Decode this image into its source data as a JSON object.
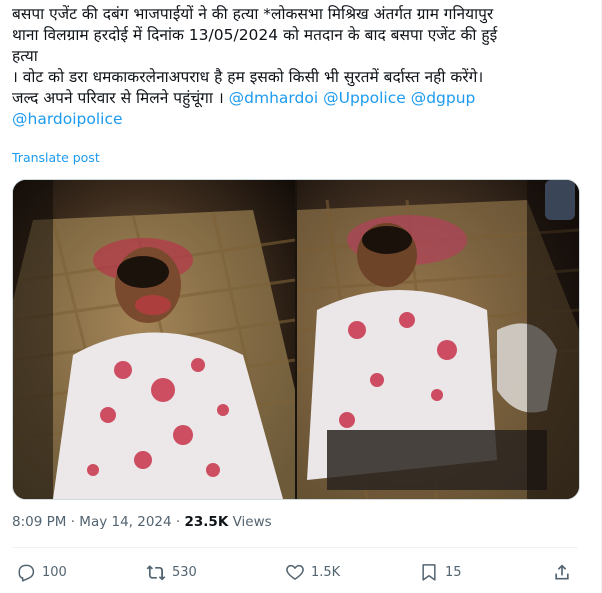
{
  "post": {
    "line1": "बसपा एजेंट की दबंग भाजपाईयों ने की हत्या *लोकसभा मिश्रिख अंतर्गत ग्राम गनियापुर",
    "line2": "थाना विलग्राम हरदोई में दिनांक 13/05/2024 को मतदान के बाद बसपा एजेंट की हुई",
    "line3": "हत्या",
    "line4": "। वोट को डरा धमकाकरलेनाअपराध है हम इसको किसी भी सुरतमें बर्दास्त नही करेंगे।",
    "line5_text": "जल्द अपने परिवार से मिलने पहुंचूंगा । ",
    "mention1": "@dmhardoi",
    "mention2": "@Uppolice",
    "mention3": "@dgpup",
    "mention4": "@hardoipolice",
    "translate_label": "Translate post"
  },
  "meta": {
    "time": "8:09 PM",
    "separator": "·",
    "date": "May 14, 2024",
    "views_count": "23.5K",
    "views_label": "Views"
  },
  "actions": {
    "replies": "100",
    "reposts": "530",
    "likes": "1.5K",
    "bookmarks": "15"
  },
  "icons": {
    "reply": "reply-icon",
    "repost": "repost-icon",
    "like": "heart-icon",
    "bookmark": "bookmark-icon",
    "share": "share-icon"
  },
  "colors": {
    "link": "#1d9bf0",
    "secondary_text": "#536471",
    "divider": "#eff3f4"
  }
}
